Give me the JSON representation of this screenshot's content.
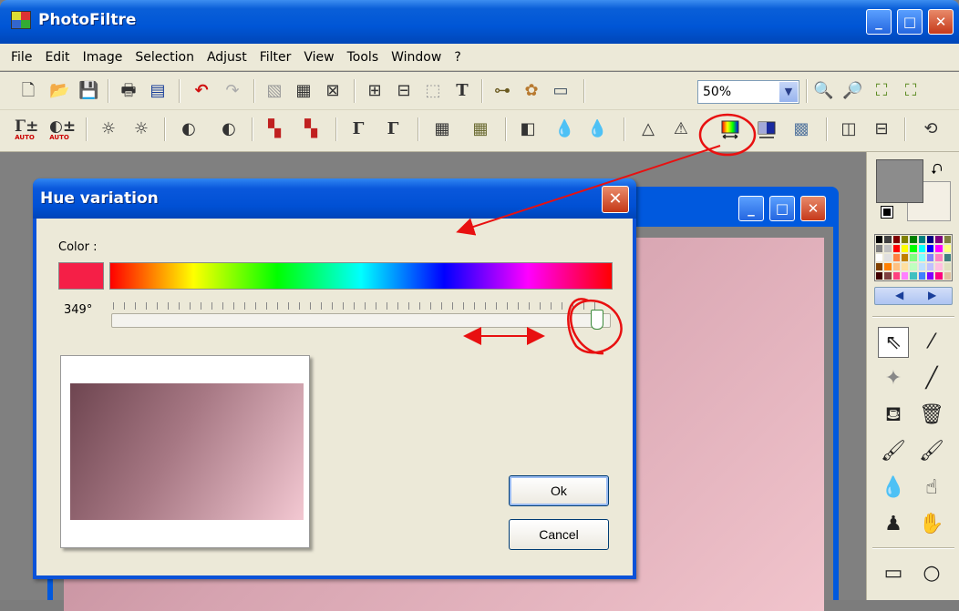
{
  "app": {
    "title": "PhotoFiltre"
  },
  "menu": [
    "File",
    "Edit",
    "Image",
    "Selection",
    "Adjust",
    "Filter",
    "View",
    "Tools",
    "Window",
    "?"
  ],
  "toolbar": {
    "zoom": "50%"
  },
  "toolbar2": {
    "auto_label": "AUTO"
  },
  "dialog": {
    "title": "Hue variation",
    "color_label": "Color :",
    "angle": "349°",
    "ok_label": "Ok",
    "cancel_label": "Cancel",
    "current_color": "#f51f47"
  },
  "colors": {
    "foreground": "#8c8c8c",
    "background": "#f3efe4",
    "annotation": "#e81010"
  },
  "palette": [
    "#000000",
    "#404040",
    "#800000",
    "#808000",
    "#008000",
    "#008080",
    "#000080",
    "#800080",
    "#808040",
    "#7f7f7f",
    "#c0c0c0",
    "#ff0000",
    "#ffff00",
    "#00ff00",
    "#00ffff",
    "#0000ff",
    "#ff00ff",
    "#ffff80",
    "#ffffff",
    "#e0e0e0",
    "#ff8040",
    "#c08000",
    "#80ff80",
    "#80ffff",
    "#8080ff",
    "#ff80c0",
    "#408080",
    "#804000",
    "#ff8000",
    "#ffc080",
    "#ffe0a0",
    "#c0ffc0",
    "#c0e0ff",
    "#c0c0ff",
    "#ffc0e0",
    "#e0e0c0",
    "#400000",
    "#804040",
    "#ff4080",
    "#ff80ff",
    "#40c0c0",
    "#4080ff",
    "#8000ff",
    "#ff0080",
    "#e0c0a0"
  ]
}
